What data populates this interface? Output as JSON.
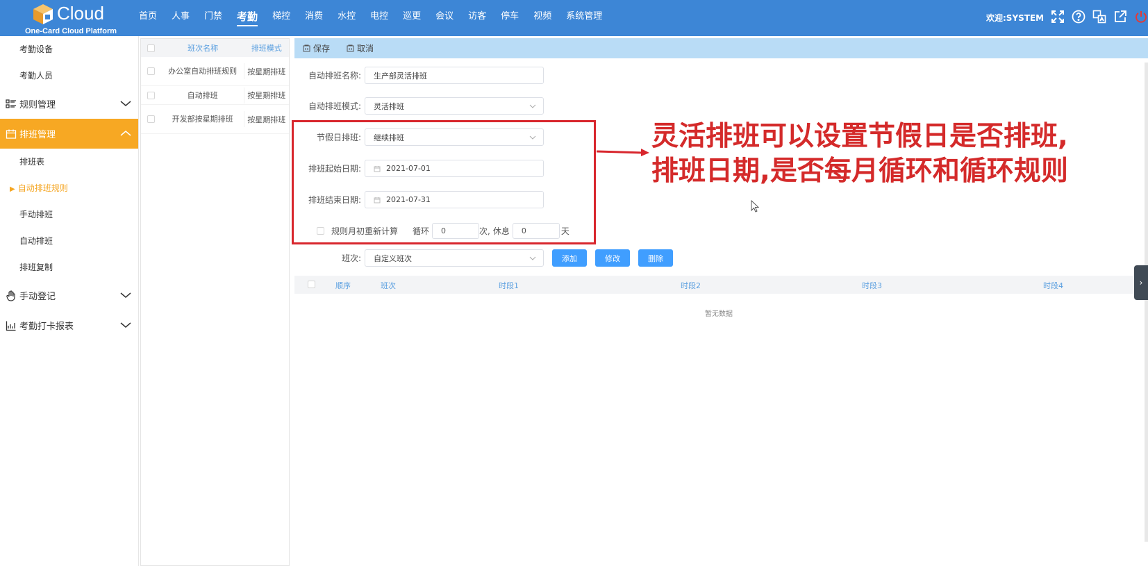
{
  "header": {
    "logo_text": "Cloud",
    "logo_sub": "One-Card Cloud Platform",
    "nav": [
      "首页",
      "人事",
      "门禁",
      "考勤",
      "梯控",
      "消费",
      "水控",
      "电控",
      "巡更",
      "会议",
      "访客",
      "停车",
      "视频",
      "系统管理"
    ],
    "active_nav": "考勤",
    "welcome": "欢迎:SYSTEM",
    "icons": [
      "fullscreen-icon",
      "help-icon",
      "language-icon",
      "external-link-icon",
      "power-icon"
    ]
  },
  "sidebar": {
    "top_items": [
      "考勤设备",
      "考勤人员"
    ],
    "rule_group": "规则管理",
    "schedule_group": "排班管理",
    "schedule_items": [
      "排班表",
      "自动排班规则",
      "手动排班",
      "自动排班",
      "排班复制"
    ],
    "active_item": "自动排班规则",
    "manual_group": "手动登记",
    "report_group": "考勤打卡报表"
  },
  "list": {
    "col_name": "班次名称",
    "col_mode": "排班模式",
    "rows": [
      {
        "name": "办公室自动排班规则",
        "mode": "按星期排班"
      },
      {
        "name": "自动排班",
        "mode": "按星期排班"
      },
      {
        "name": "开发部按星期排班",
        "mode": "按星期排班"
      }
    ]
  },
  "toolbar": {
    "save": "保存",
    "cancel": "取消"
  },
  "form": {
    "name_label": "自动排班名称:",
    "name_value": "生产部灵活排班",
    "mode_label": "自动排班模式:",
    "mode_value": "灵活排班",
    "holiday_label": "节假日排班:",
    "holiday_value": "继续排班",
    "start_label": "排班起始日期:",
    "start_value": "2021-07-01",
    "end_label": "排班结束日期:",
    "end_value": "2021-07-31",
    "recalc_label": "规则月初重新计算",
    "cycle_label": "循环",
    "cycle_value": "0",
    "times_label": "次,",
    "rest_label": "休息",
    "rest_value": "0",
    "days_label": "天",
    "shift_label": "班次:",
    "shift_value": "自定义班次",
    "add": "添加",
    "edit": "修改",
    "delete": "删除"
  },
  "table": {
    "headers": [
      "顺序",
      "班次",
      "时段1",
      "时段2",
      "时段3",
      "时段4"
    ],
    "empty": "暂无数据"
  },
  "annotation": {
    "line1": "灵活排班可以设置节假日是否排班,",
    "line2": "排班日期,是否每月循环和循环规则",
    "color": "#d42a2a"
  },
  "colors": {
    "topbar": "#3d86d6",
    "active_group": "#f7a823",
    "primary_button": "#409eff"
  }
}
